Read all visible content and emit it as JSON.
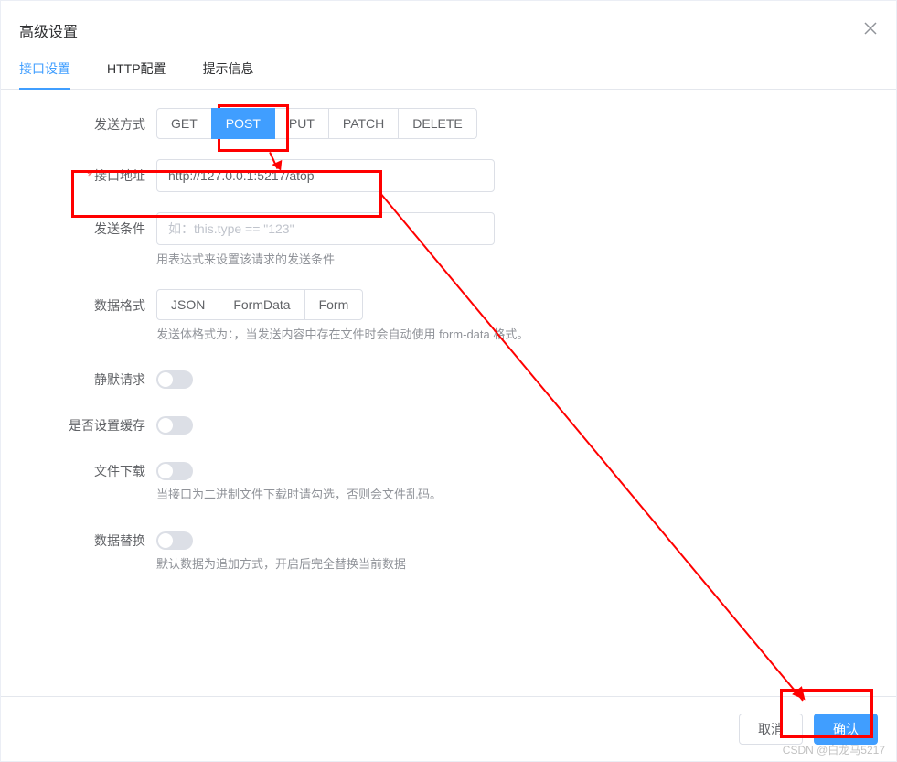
{
  "dialog": {
    "title": "高级设置"
  },
  "tabs": {
    "items": [
      {
        "label": "接口设置",
        "active": true
      },
      {
        "label": "HTTP配置",
        "active": false
      },
      {
        "label": "提示信息",
        "active": false
      }
    ]
  },
  "form": {
    "method": {
      "label": "发送方式",
      "options": [
        "GET",
        "POST",
        "PUT",
        "PATCH",
        "DELETE"
      ],
      "selected": "POST"
    },
    "url": {
      "label": "接口地址",
      "required": true,
      "value": "http://127.0.0.1:5217/atop"
    },
    "condition": {
      "label": "发送条件",
      "placeholder": "如：this.type == \"123\"",
      "help": "用表达式来设置该请求的发送条件"
    },
    "data_format": {
      "label": "数据格式",
      "options": [
        "JSON",
        "FormData",
        "Form"
      ],
      "selected": "",
      "help": "发送体格式为：，当发送内容中存在文件时会自动使用 form-data 格式。"
    },
    "silent": {
      "label": "静默请求",
      "value": false
    },
    "cache": {
      "label": "是否设置缓存",
      "value": false
    },
    "download": {
      "label": "文件下载",
      "value": false,
      "help": "当接口为二进制文件下载时请勾选，否则会文件乱码。"
    },
    "replace": {
      "label": "数据替换",
      "value": false,
      "help": "默认数据为追加方式，开启后完全替换当前数据"
    }
  },
  "footer": {
    "cancel": "取消",
    "confirm": "确认"
  },
  "watermark": "CSDN @白龙马5217"
}
